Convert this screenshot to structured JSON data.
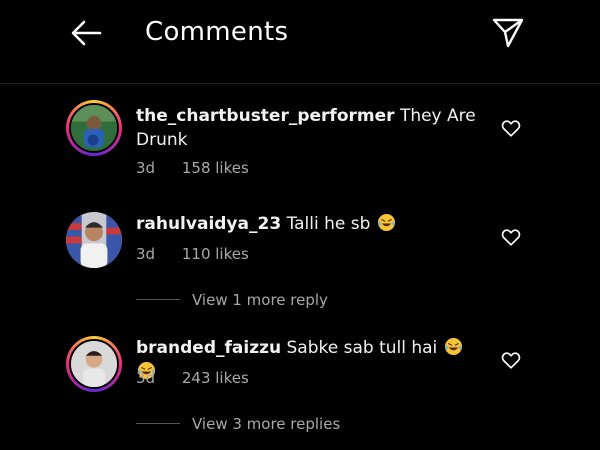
{
  "header": {
    "title": "Comments",
    "back_icon": "arrow-left-icon",
    "send_icon": "send-icon"
  },
  "comments": [
    {
      "username": "the_chartbuster_performer",
      "text_line1": "They Are",
      "text_line2": "Drunk",
      "age": "3d",
      "likes": "158 likes"
    },
    {
      "username": "rahulvaidya_23",
      "text": "Talli he sb",
      "emoji_count": 1,
      "age": "3d",
      "likes": "110 likes",
      "replies_link": "View 1 more reply"
    },
    {
      "username": "branded_faizzu",
      "text": "Sabke sab tull hai",
      "emoji_count": 2,
      "age": "3d",
      "likes": "243 likes",
      "replies_link": "View 3 more replies"
    }
  ],
  "colors": {
    "background": "#000000",
    "text": "#f2f2f2",
    "meta": "#a8a8a8",
    "story_ring_start": "#f9ce34",
    "story_ring_mid": "#ee2a7b"
  }
}
